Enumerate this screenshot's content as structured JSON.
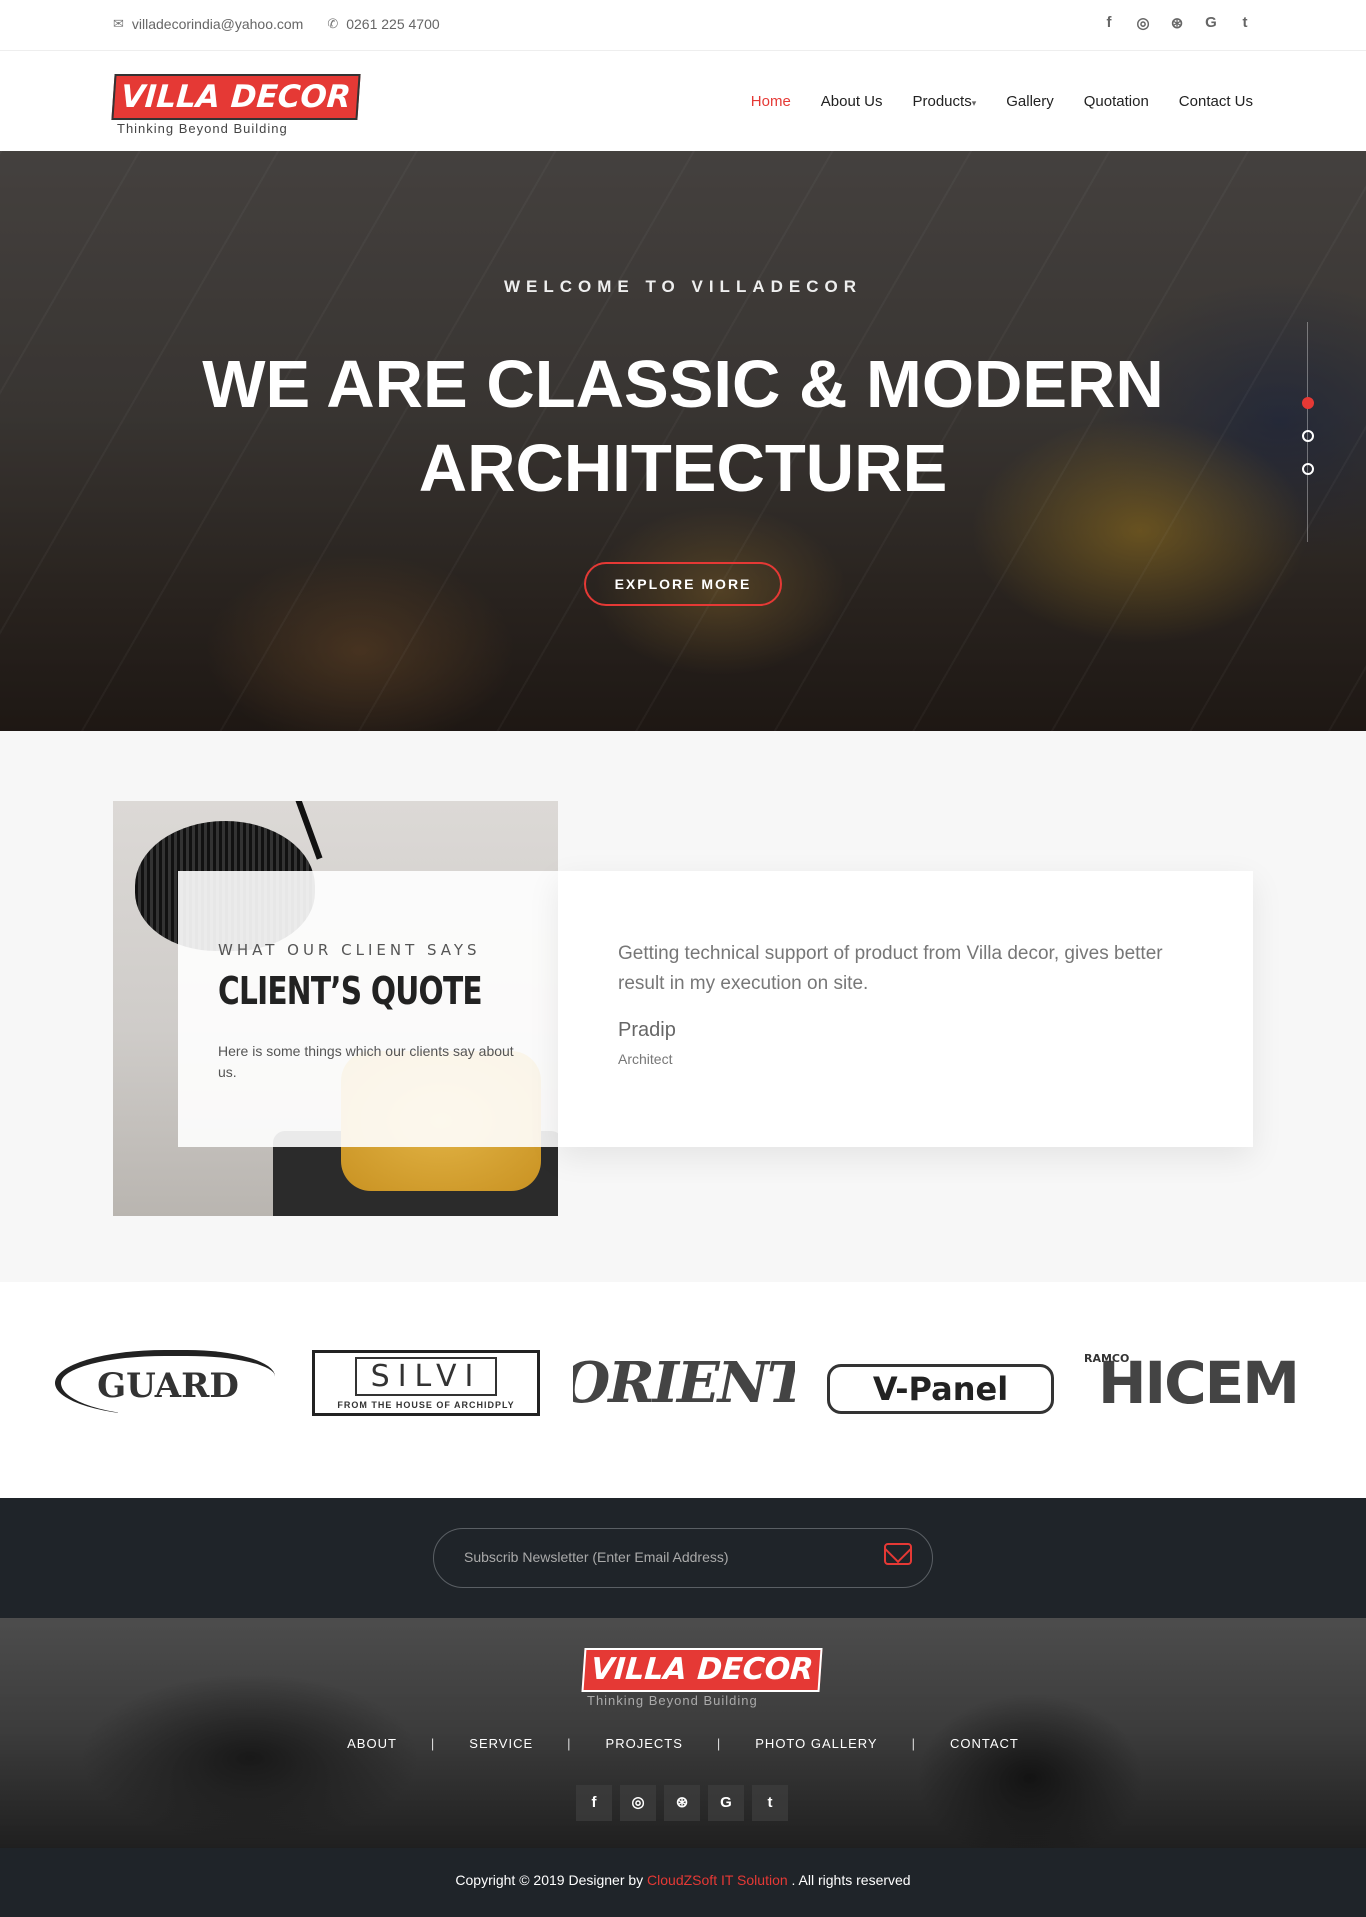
{
  "topbar": {
    "email": "villadecorindia@yahoo.com",
    "phone": "0261 225 4700",
    "social": [
      "f",
      "◎",
      "⊛",
      "G",
      "t"
    ]
  },
  "logo": {
    "name": "VILLA DECOR",
    "tagline": "Thinking Beyond Building"
  },
  "nav": {
    "home": "Home",
    "about": "About Us",
    "products": "Products",
    "gallery": "Gallery",
    "quotation": "Quotation",
    "contact": "Contact Us"
  },
  "hero": {
    "subtitle": "WELCOME TO VILLADECOR",
    "title_line1": "WE ARE CLASSIC & MODERN",
    "title_line2": "ARCHITECTURE",
    "button": "EXPLORE MORE",
    "active_slide": 1,
    "slides": 3
  },
  "testimonial": {
    "eyebrow": "WHAT OUR CLIENT SAYS",
    "title": "CLIENT’S QUOTE",
    "description": "Here is some things which our clients say about us.",
    "quote": "Getting technical support of product from Villa decor, gives better result in my execution on site.",
    "name": "Pradip",
    "role": "Architect"
  },
  "brands": {
    "cello": "GUARD",
    "silvi": "SILVI",
    "silvi_sub": "FROM THE HOUSE OF ARCHIDPLY",
    "orient": "ORIENT",
    "vpanel": "V-Panel",
    "hicem": "HICEM",
    "hicem_small": "RAMCO"
  },
  "newsletter": {
    "placeholder": "Subscrib Newsletter (Enter Email Address)"
  },
  "footer": {
    "logo_name": "VILLA DECOR",
    "tagline": "Thinking Beyond Building",
    "links": {
      "about": "ABOUT",
      "service": "SERVICE",
      "projects": "PROJECTS",
      "gallery": "PHOTO GALLERY",
      "contact": "CONTACT"
    },
    "separator": "|",
    "social": [
      "f",
      "◎",
      "⊛",
      "G",
      "t"
    ]
  },
  "copyright": {
    "prefix": "Copyright © 2019 Designer by ",
    "company": "CloudZSoft IT Solution",
    "suffix": " . All rights reserved"
  },
  "colors": {
    "accent": "#e53935",
    "dark": "#1f2429"
  }
}
